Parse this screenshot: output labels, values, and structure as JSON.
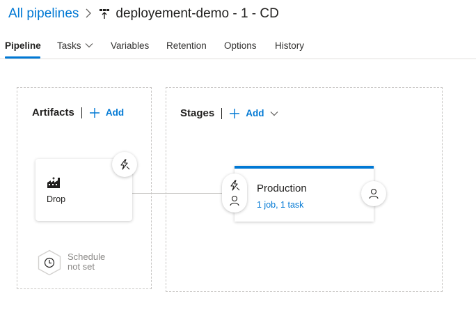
{
  "breadcrumb": {
    "parent": "All pipelines",
    "separator": ">",
    "title": "deployement-demo - 1 - CD"
  },
  "tabs": [
    {
      "label": "Pipeline",
      "active": true
    },
    {
      "label": "Tasks",
      "dropdown": true
    },
    {
      "label": "Variables"
    },
    {
      "label": "Retention"
    },
    {
      "label": "Options"
    },
    {
      "label": "History"
    }
  ],
  "artifacts": {
    "title": "Artifacts",
    "add_label": "Add",
    "items": [
      {
        "name": "Drop",
        "icon": "build-artifact-icon"
      }
    ],
    "schedule": {
      "line1": "Schedule",
      "line2": "not set",
      "icon": "clock-icon"
    }
  },
  "stages": {
    "title": "Stages",
    "add_label": "Add",
    "items": [
      {
        "name": "Production",
        "meta": "1 job, 1 task"
      }
    ]
  },
  "colors": {
    "accent": "#0078d4",
    "text": "#201f1e",
    "muted": "#8a8886",
    "border": "#c8c6c4"
  }
}
